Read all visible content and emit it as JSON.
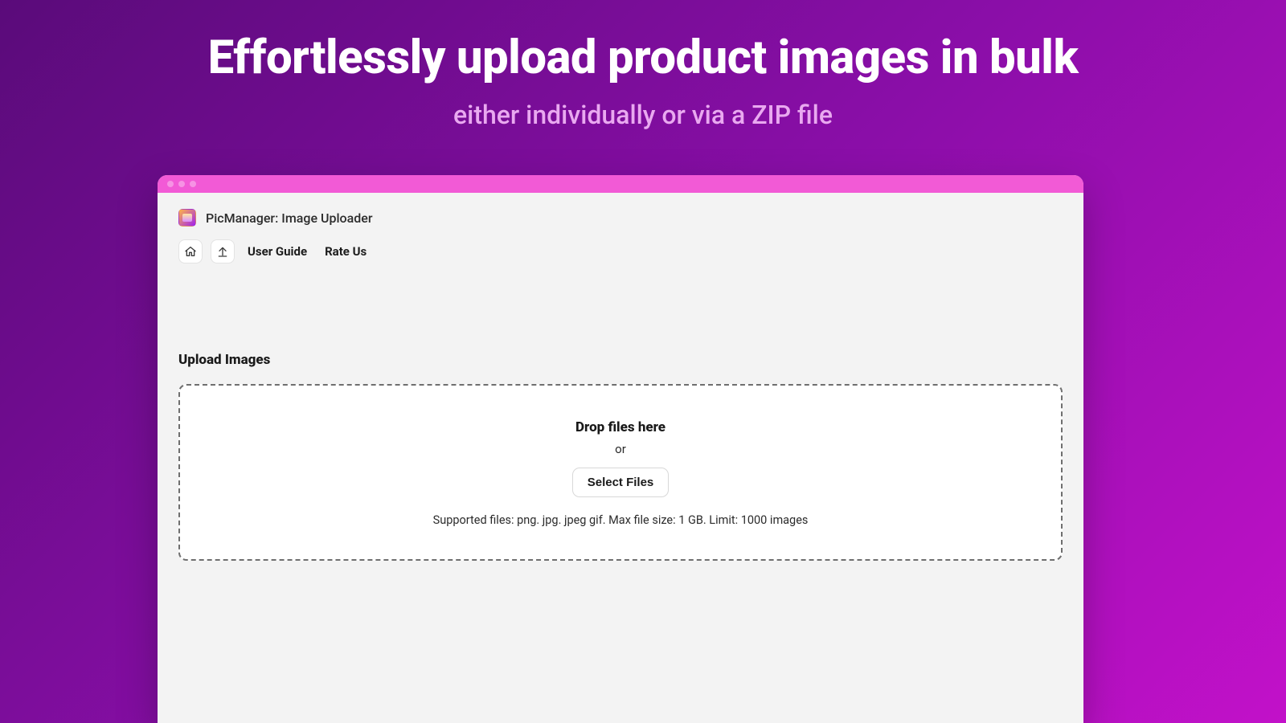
{
  "hero": {
    "title": "Effortlessly upload product images in bulk",
    "subtitle": "either individually or via a ZIP file"
  },
  "app": {
    "title": "PicManager: Image Uploader"
  },
  "toolbar": {
    "home_icon": "home-icon",
    "upload_icon": "upload-icon",
    "links": [
      {
        "label": "User Guide"
      },
      {
        "label": "Rate Us"
      }
    ]
  },
  "upload": {
    "section_title": "Upload Images",
    "drop_title": "Drop files here",
    "or_label": "or",
    "select_button": "Select Files",
    "hint": "Supported files: png. jpg. jpeg gif. Max file size: 1 GB. Limit: 1000 images"
  }
}
